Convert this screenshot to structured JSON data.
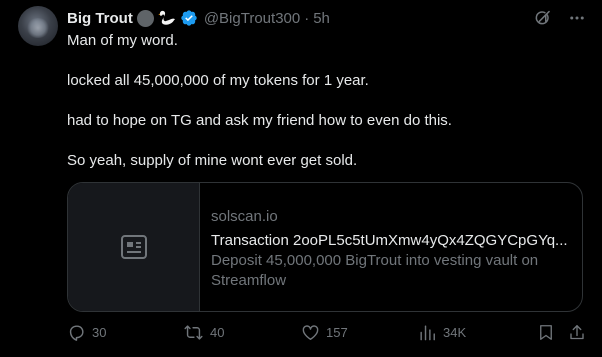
{
  "author": {
    "name": "Big Trout",
    "handle": "@BigTrout300",
    "time": "5h"
  },
  "tweet": {
    "lines": [
      "Man of my word.",
      "",
      "locked all 45,000,000 of my tokens for 1 year.",
      "",
      "had to hope on TG and ask my friend how to even do this.",
      "",
      "So yeah, supply of mine wont ever get sold."
    ]
  },
  "card": {
    "domain": "solscan.io",
    "title": "Transaction 2ooPL5c5tUmXmw4yQx4ZQGYCpGYq...",
    "description": "Deposit 45,000,000 BigTrout into vesting vault on Streamflow"
  },
  "actions": {
    "replies": "30",
    "reposts": "40",
    "likes": "157",
    "views": "34K"
  },
  "colors": {
    "background": "#000000",
    "text": "#e7e9ea",
    "muted": "#71767b",
    "border": "#2f3336",
    "verified": "#1d9bf0"
  }
}
